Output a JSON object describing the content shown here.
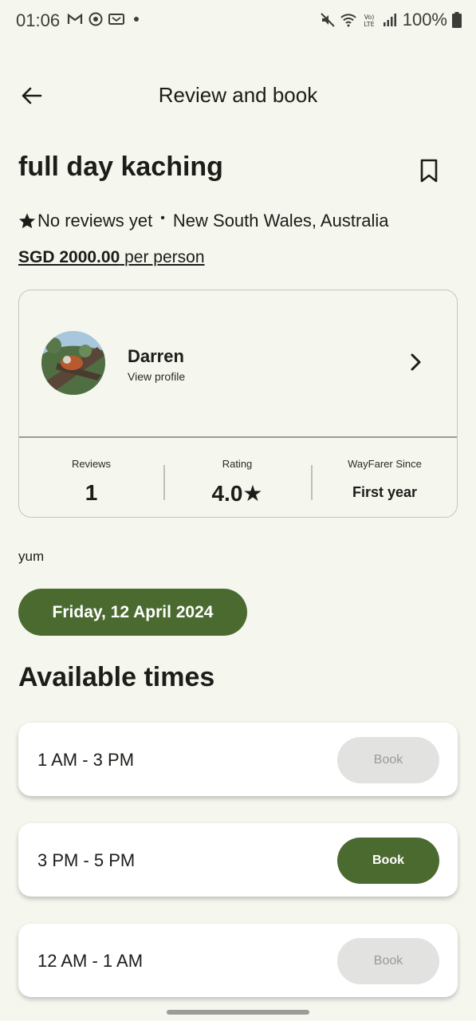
{
  "status_bar": {
    "time": "01:06",
    "battery": "100%",
    "icons": [
      "gmail-icon",
      "sync-icon",
      "voicemail-icon",
      "mute-icon",
      "wifi-icon",
      "volte-icon",
      "signal-icon",
      "battery-icon"
    ]
  },
  "app_bar": {
    "title": "Review and book",
    "back_icon": "arrow-left-icon"
  },
  "listing": {
    "title": "full day kaching",
    "reviews_text": "No reviews yet",
    "separator": "•",
    "location": "New South Wales, Australia",
    "price_amount": "SGD 2000.00",
    "price_unit": "per person"
  },
  "host": {
    "name": "Darren",
    "view_profile": "View profile",
    "stats": {
      "reviews_label": "Reviews",
      "reviews_value": "1",
      "rating_label": "Rating",
      "rating_value": "4.0★",
      "since_label": "WayFarer Since",
      "since_value": "First year"
    }
  },
  "description": "yum",
  "date_chip": "Friday, 12 April 2024",
  "section_title": "Available times",
  "slots": [
    {
      "time": "1 AM - 3 PM",
      "button": "Book",
      "enabled": false
    },
    {
      "time": "3 PM - 5 PM",
      "button": "Book",
      "enabled": true
    },
    {
      "time": "12 AM - 1 AM",
      "button": "Book",
      "enabled": false
    }
  ],
  "colors": {
    "background": "#f5f6ee",
    "primary": "#4a6a30",
    "disabled_button": "#e2e2e0"
  }
}
